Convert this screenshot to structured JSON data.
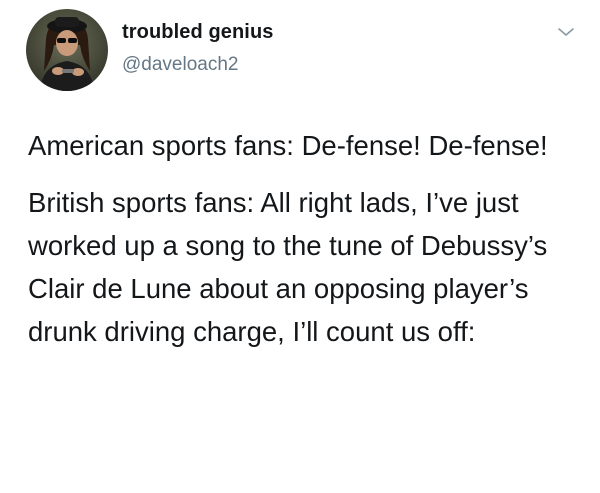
{
  "author": {
    "display_name": "troubled genius",
    "handle": "@daveloach2",
    "avatar_icon": "profile-photo"
  },
  "menu_icon": "chevron-down-icon",
  "tweet": {
    "paragraph_1": "American sports fans: De-fense! De-fense!",
    "paragraph_2": "British sports fans: All right lads, I’ve just worked up a song to the tune of Debussy’s Clair de Lune about an opposing player’s drunk driving charge, I’ll count us off:"
  },
  "colors": {
    "text_primary": "#14171a",
    "text_secondary": "#657786",
    "chevron": "#8899a6",
    "background": "#ffffff"
  }
}
